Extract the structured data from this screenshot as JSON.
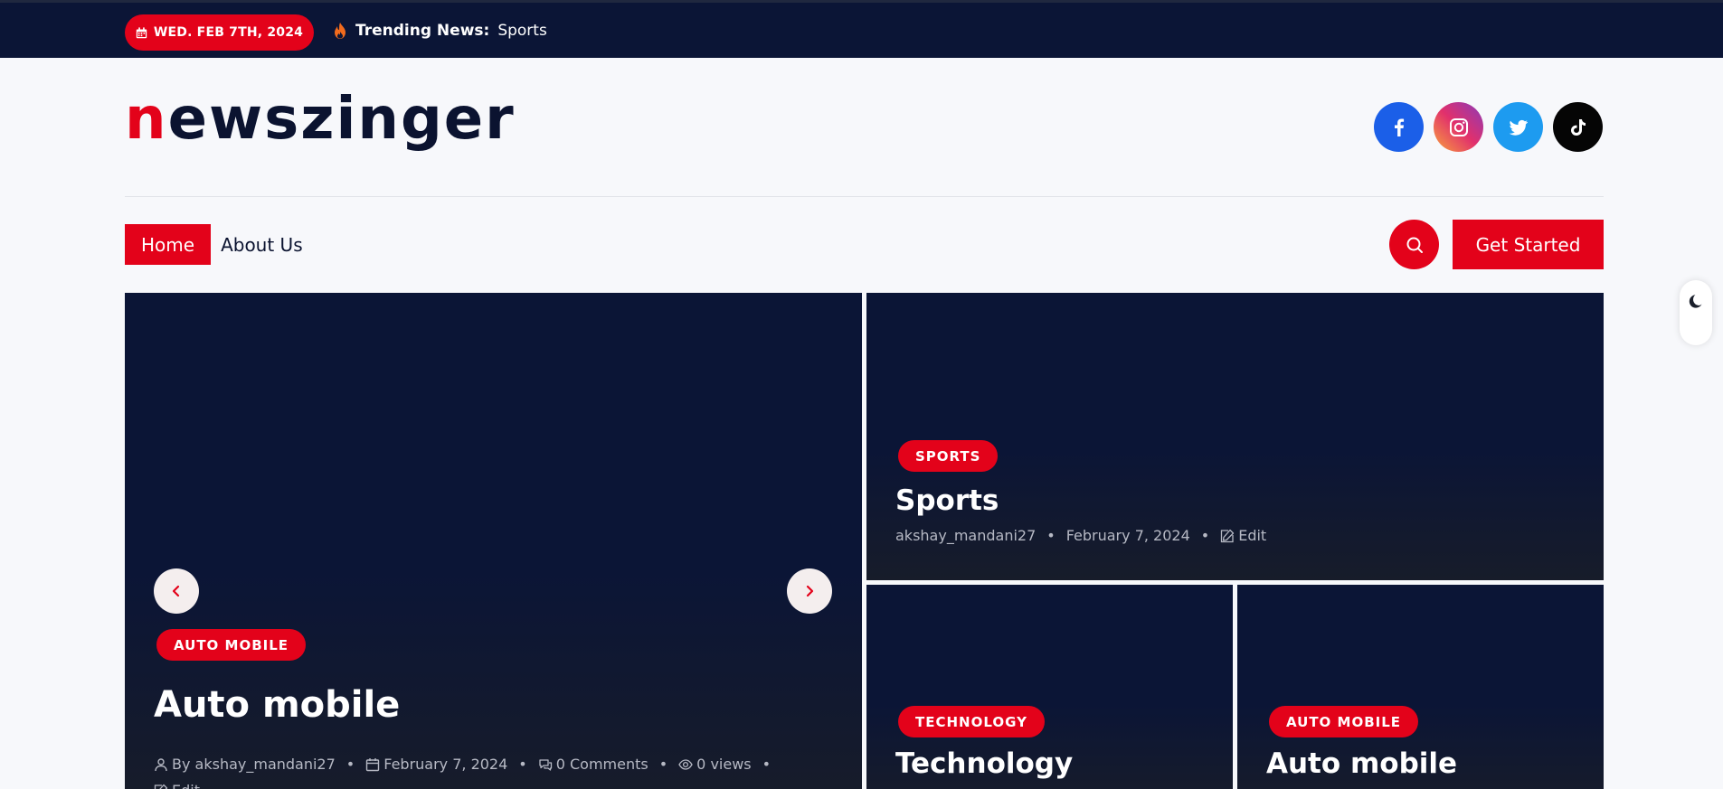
{
  "topbar": {
    "date": "WED. FEB 7TH, 2024",
    "trending_label": "Trending News:",
    "trending_value": "Sports"
  },
  "logo": {
    "first_letter": "n",
    "rest": "ewszinger"
  },
  "socials": [
    {
      "icon": "facebook-icon",
      "color": "#1b5fe8"
    },
    {
      "icon": "instagram-icon",
      "color": "#e1306c"
    },
    {
      "icon": "twitter-icon",
      "color": "#1d9bf0"
    },
    {
      "icon": "tiktok-icon",
      "color": "#050505"
    }
  ],
  "nav": {
    "items": [
      {
        "label": "Home",
        "active": true
      },
      {
        "label": "About Us",
        "active": false
      }
    ],
    "cta_label": "Get Started"
  },
  "colors": {
    "accent": "#e3021a",
    "dark": "#0b1536"
  },
  "featured": {
    "category": "AUTO MOBILE",
    "title": "Auto mobile",
    "author": "By akshay_mandani27",
    "date": "February 7, 2024",
    "comments": "0 Comments",
    "views": "0 views",
    "edit": "Edit"
  },
  "sports_card": {
    "category": "SPORTS",
    "title": "Sports",
    "author": "akshay_mandani27",
    "date": "February 7, 2024",
    "edit": "Edit"
  },
  "tech_card": {
    "category": "TECHNOLOGY",
    "title": "Technology"
  },
  "auto_card": {
    "category": "AUTO MOBILE",
    "title": "Auto mobile"
  }
}
